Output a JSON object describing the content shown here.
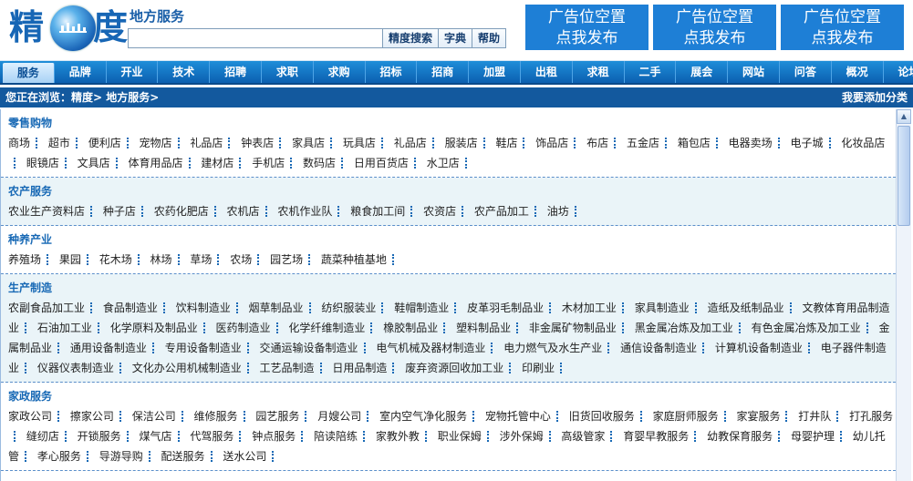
{
  "logo": {
    "char1": "精",
    "char2": "度"
  },
  "site_title": "地方服务",
  "search": {
    "value": "",
    "buttons": [
      "精度搜索",
      "字典",
      "帮助"
    ]
  },
  "ads": [
    {
      "line1": "广告位空置",
      "line2": "点我发布"
    },
    {
      "line1": "广告位空置",
      "line2": "点我发布"
    },
    {
      "line1": "广告位空置",
      "line2": "点我发布"
    }
  ],
  "nav": [
    "服务",
    "品牌",
    "开业",
    "技术",
    "招聘",
    "求职",
    "求购",
    "招标",
    "招商",
    "加盟",
    "出租",
    "求租",
    "二手",
    "展会",
    "网站",
    "问答",
    "概况",
    "论坛"
  ],
  "breadcrumb": "您正在浏览：精度> 地方服务>",
  "add_category": "我要添加分类",
  "categories": [
    {
      "title": "零售购物",
      "items": [
        "商场",
        "超市",
        "便利店",
        "宠物店",
        "礼品店",
        "钟表店",
        "家具店",
        "玩具店",
        "礼品店",
        "服装店",
        "鞋店",
        "饰品店",
        "布店",
        "五金店",
        "箱包店",
        "电器卖场",
        "电子城",
        "化妆品店",
        "眼镜店",
        "文具店",
        "体育用品店",
        "建材店",
        "手机店",
        "数码店",
        "日用百货店",
        "水卫店"
      ]
    },
    {
      "title": "农产服务",
      "items": [
        "农业生产资料店",
        "种子店",
        "农药化肥店",
        "农机店",
        "农机作业队",
        "粮食加工间",
        "农资店",
        "农产品加工",
        "油坊"
      ]
    },
    {
      "title": "种养产业",
      "items": [
        "养殖场",
        "果园",
        "花木场",
        "林场",
        "草场",
        "农场",
        "园艺场",
        "蔬菜种植基地"
      ]
    },
    {
      "title": "生产制造",
      "items": [
        "农副食品加工业",
        "食品制造业",
        "饮料制造业",
        "烟草制品业",
        "纺织服装业",
        "鞋帽制造业",
        "皮革羽毛制品业",
        "木材加工业",
        "家具制造业",
        "造纸及纸制品业",
        "文教体育用品制造业",
        "石油加工业",
        "化学原料及制品业",
        "医药制造业",
        "化学纤维制造业",
        "橡胶制品业",
        "塑料制品业",
        "非金属矿物制品业",
        "黑金属冶炼及加工业",
        "有色金属冶炼及加工业",
        "金属制品业",
        "通用设备制造业",
        "专用设备制造业",
        "交通运输设备制造业",
        "电气机械及器材制造业",
        "电力燃气及水生产业",
        "通信设备制造业",
        "计算机设备制造业",
        "电子器件制造业",
        "仪器仪表制造业",
        "文化办公用机械制造业",
        "工艺品制造",
        "日用品制造",
        "废弃资源回收加工业",
        "印刷业"
      ]
    },
    {
      "title": "家政服务",
      "items": [
        "家政公司",
        "擦家公司",
        "保洁公司",
        "维修服务",
        "园艺服务",
        "月嫂公司",
        "室内空气净化服务",
        "宠物托管中心",
        "旧货回收服务",
        "家庭厨师服务",
        "家宴服务",
        "打井队",
        "打孔服务",
        "缝纫店",
        "开锁服务",
        "煤气店",
        "代驾服务",
        "钟点服务",
        "陪读陪练",
        "家教外教",
        "职业保姆",
        "涉外保姆",
        "高级管家",
        "育婴早教服务",
        "幼教保育服务",
        "母婴护理",
        "幼儿托管",
        "孝心服务",
        "导游导购",
        "配送服务",
        "送水公司"
      ]
    }
  ]
}
